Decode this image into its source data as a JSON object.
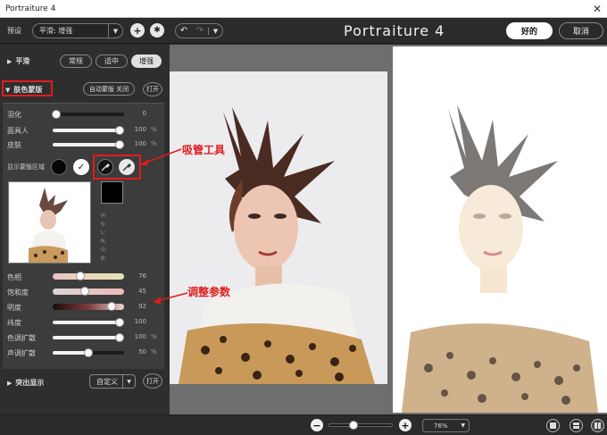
{
  "window": {
    "title": "Portraiture 4",
    "close_glyph": "✕"
  },
  "toolbar": {
    "preset_label": "预设",
    "preset_value": "平滑: 增强",
    "add_glyph": "+",
    "settings_glyph": "✱",
    "app_title": "Portraiture 4",
    "ok_label": "好的",
    "cancel_label": "取消"
  },
  "smoothing": {
    "title": "平滑",
    "options": [
      "常规",
      "适中",
      "增强"
    ],
    "selected": "增强"
  },
  "skin_mask": {
    "title": "肤色蒙版",
    "auto_mask_label": "自动蒙版 关闭",
    "toggle_label": "打开",
    "feather": {
      "label": "羽化",
      "value": "0"
    },
    "mask_opacity": {
      "label": "面具人",
      "value": "100",
      "unit": "%"
    },
    "skin": {
      "label": "皮肤",
      "value": "100",
      "unit": "%"
    },
    "show_mask_label": "显示蒙版区域",
    "hsl_labels": [
      "H:",
      "S:",
      "L:",
      "",
      "R:",
      "G:",
      "B:"
    ],
    "hue": {
      "label": "色相",
      "value": "76"
    },
    "saturation": {
      "label": "饱和度",
      "value": "45"
    },
    "brightness": {
      "label": "明度",
      "value": "92"
    },
    "latitude": {
      "label": "纬度",
      "value": "100"
    },
    "color_expand": {
      "label": "色调扩散",
      "value": "100",
      "unit": "%"
    },
    "tone_expand": {
      "label": "声调扩散",
      "value": "50",
      "unit": "%"
    }
  },
  "highlight": {
    "title": "突出显示",
    "custom_label": "自定义",
    "toggle_label": "打开"
  },
  "annotations": {
    "eyedropper": "吸管工具",
    "adjust": "调整参数"
  },
  "zoom": {
    "value": "76%",
    "minus": "−",
    "plus": "+"
  },
  "colors": {
    "accent_red": "#e21b1b",
    "panel_bg": "#3c3c3c"
  }
}
